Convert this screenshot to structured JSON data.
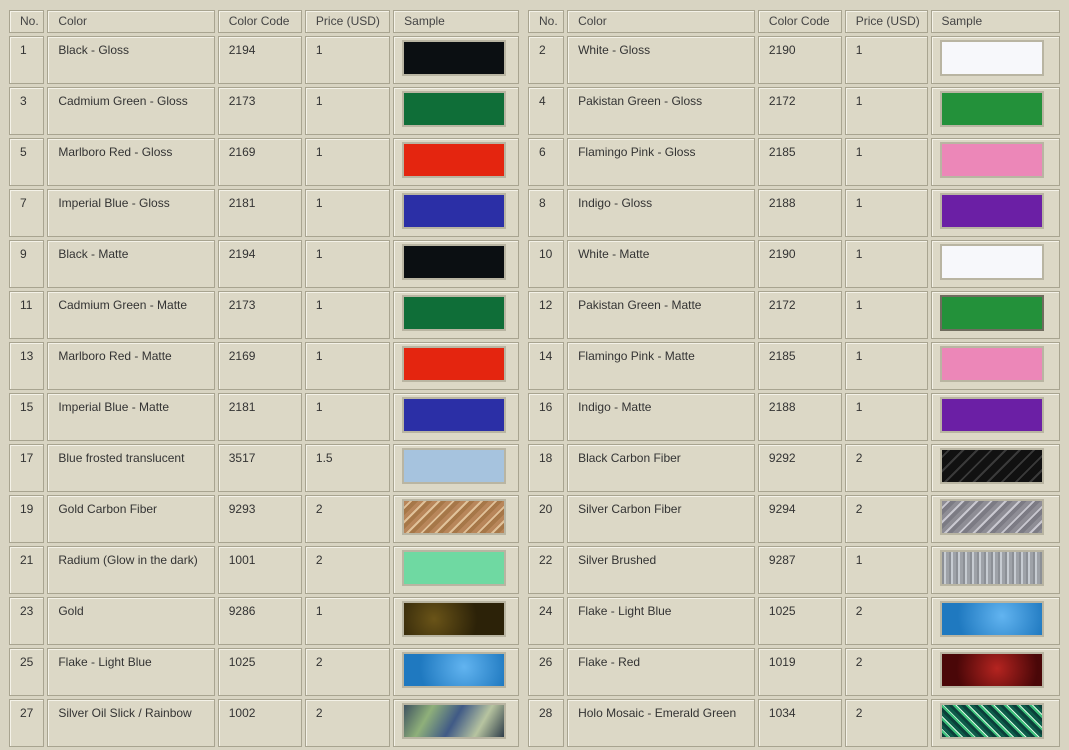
{
  "headers": {
    "no": "No.",
    "color": "Color",
    "code": "Color Code",
    "price": "Price (USD)",
    "sample": "Sample"
  },
  "left": [
    {
      "no": "1",
      "color": "Black - Gloss",
      "code": "2194",
      "price": "1",
      "swatch": "black-gloss-swatch"
    },
    {
      "no": "3",
      "color": "Cadmium Green - Gloss",
      "code": "2173",
      "price": "1",
      "swatch": "cadmium-green-swatch"
    },
    {
      "no": "5",
      "color": "Marlboro Red - Gloss",
      "code": "2169",
      "price": "1",
      "swatch": "marlboro-red-swatch"
    },
    {
      "no": "7",
      "color": "Imperial Blue - Gloss",
      "code": "2181",
      "price": "1",
      "swatch": "imperial-blue-swatch"
    },
    {
      "no": "9",
      "color": "Black - Matte",
      "code": "2194",
      "price": "1",
      "swatch": "black-matte-swatch"
    },
    {
      "no": "11",
      "color": "Cadmium Green - Matte",
      "code": "2173",
      "price": "1",
      "swatch": "cadmium-green-swatch"
    },
    {
      "no": "13",
      "color": "Marlboro Red - Matte",
      "code": "2169",
      "price": "1",
      "swatch": "marlboro-red-swatch"
    },
    {
      "no": "15",
      "color": "Imperial Blue - Matte",
      "code": "2181",
      "price": "1",
      "swatch": "imperial-blue-swatch"
    },
    {
      "no": "17",
      "color": "Blue frosted translucent",
      "code": "3517",
      "price": "1.5",
      "swatch": "blue-frosted-swatch"
    },
    {
      "no": "19",
      "color": "Gold Carbon Fiber",
      "code": "9293",
      "price": "2",
      "swatch": "gold-carbon-fiber-swatch"
    },
    {
      "no": "21",
      "color": "Radium (Glow in the dark)",
      "code": "1001",
      "price": "2",
      "swatch": "radium-swatch"
    },
    {
      "no": "23",
      "color": "Gold",
      "code": "9286",
      "price": "1",
      "swatch": "gold-swatch"
    },
    {
      "no": "25",
      "color": "Flake - Light Blue",
      "code": "1025",
      "price": "2",
      "swatch": "flake-light-blue-swatch"
    },
    {
      "no": "27",
      "color": "Silver Oil Slick / Rainbow",
      "code": "1002",
      "price": "2",
      "swatch": "oil-slick-rainbow-swatch"
    }
  ],
  "right": [
    {
      "no": "2",
      "color": "White - Gloss",
      "code": "2190",
      "price": "1",
      "swatch": "white-gloss-swatch"
    },
    {
      "no": "4",
      "color": "Pakistan Green - Gloss",
      "code": "2172",
      "price": "1",
      "swatch": "pakistan-green-swatch"
    },
    {
      "no": "6",
      "color": "Flamingo Pink - Gloss",
      "code": "2185",
      "price": "1",
      "swatch": "flamingo-pink-swatch"
    },
    {
      "no": "8",
      "color": "Indigo - Gloss",
      "code": "2188",
      "price": "1",
      "swatch": "indigo-swatch"
    },
    {
      "no": "10",
      "color": "White - Matte",
      "code": "2190",
      "price": "1",
      "swatch": "white-matte-swatch"
    },
    {
      "no": "12",
      "color": "Pakistan Green - Matte",
      "code": "2172",
      "price": "1",
      "swatch": "pakistan-green-swatch"
    },
    {
      "no": "14",
      "color": "Flamingo Pink - Matte",
      "code": "2185",
      "price": "1",
      "swatch": "flamingo-pink-swatch"
    },
    {
      "no": "16",
      "color": "Indigo - Matte",
      "code": "2188",
      "price": "1",
      "swatch": "indigo-swatch"
    },
    {
      "no": "18",
      "color": "Black Carbon Fiber",
      "code": "9292",
      "price": "2",
      "swatch": "black-carbon-fiber-swatch"
    },
    {
      "no": "20",
      "color": "Silver Carbon Fiber",
      "code": "9294",
      "price": "2",
      "swatch": "silver-carbon-fiber-swatch"
    },
    {
      "no": "22",
      "color": "Silver Brushed",
      "code": "9287",
      "price": "1",
      "swatch": "silver-brushed-swatch"
    },
    {
      "no": "24",
      "color": "Flake - Light Blue",
      "code": "1025",
      "price": "2",
      "swatch": "flake-light-blue-swatch"
    },
    {
      "no": "26",
      "color": "Flake - Red",
      "code": "1019",
      "price": "2",
      "swatch": "flake-red-swatch"
    },
    {
      "no": "28",
      "color": "Holo Mosaic - Emerald Green",
      "code": "1034",
      "price": "2",
      "swatch": "holo-mosaic-emerald-swatch"
    }
  ],
  "colors": {
    "background": "#d8d4c2",
    "cell": "#dcd8c6",
    "border": "#a8a490"
  }
}
